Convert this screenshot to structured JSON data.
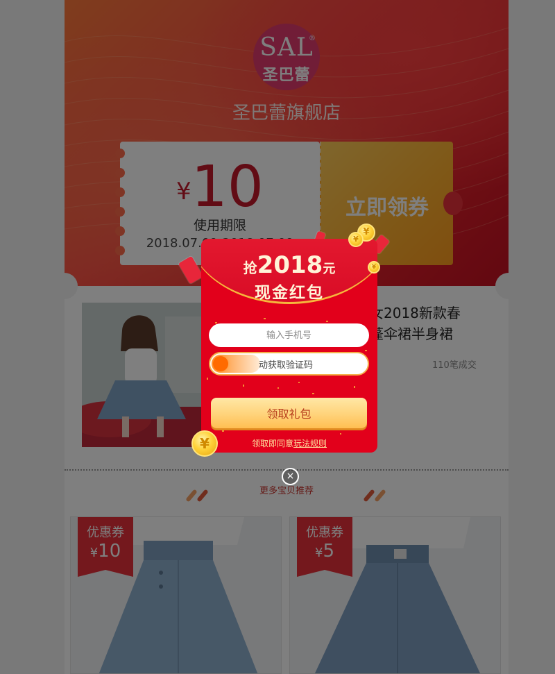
{
  "shop": {
    "logo_en": "SAL",
    "logo_reg": "®",
    "logo_cn": "圣巴蕾",
    "name": "圣巴蕾旗舰店"
  },
  "coupon": {
    "currency": "¥",
    "amount": "10",
    "condition": "使用期限",
    "date": "2018.07.09-2018.07.09",
    "cta": "立即领券"
  },
  "product": {
    "title_line1": "女2018新款春",
    "title_line2": "蓬伞裙半身裙",
    "sales": "110笔成交"
  },
  "section": {
    "more_label": "更多宝贝推荐"
  },
  "grid": [
    {
      "badge_label": "优惠券",
      "currency": "¥",
      "amount": "10"
    },
    {
      "badge_label": "优惠券",
      "currency": "¥",
      "amount": "5"
    }
  ],
  "modal": {
    "title_pre": "抢",
    "title_year": "2018",
    "title_post": "元",
    "title_line2": "现金红包",
    "phone_placeholder": "输入手机号",
    "slider_label": "动获取验证码",
    "claim_button": "领取礼包",
    "rules_prefix": "领取即同意",
    "rules_link": "玩法规则",
    "close_symbol": "×",
    "coin_symbol": "¥"
  },
  "colors": {
    "brand_red": "#e2001b",
    "gold": "#ffd37a",
    "banner_orange": "#ff7a3c"
  }
}
